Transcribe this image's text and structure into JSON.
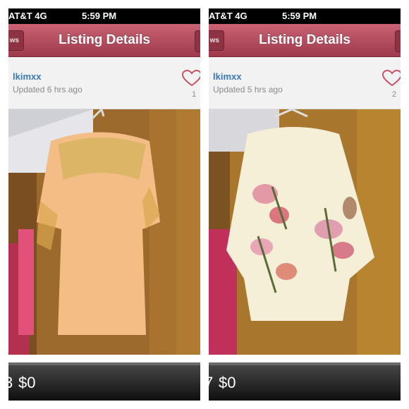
{
  "panels": [
    {
      "status": {
        "carrier": "AT&T  4G",
        "time": "5:59 PM"
      },
      "nav": {
        "back_label": "ws",
        "title": "Listing Details"
      },
      "seller": {
        "username": "lkimxx",
        "updated": "Updated 6 hrs ago",
        "likes": "1",
        "heart_icon": "heart-outline-icon"
      },
      "price": {
        "cut_number": "3",
        "amount": "$0"
      }
    },
    {
      "status": {
        "carrier": "AT&T  4G",
        "time": "5:59 PM"
      },
      "nav": {
        "back_label": "ws",
        "title": "Listing Details"
      },
      "seller": {
        "username": "lkimxx",
        "updated": "Updated 5 hrs ago",
        "likes": "2",
        "heart_icon": "heart-outline-icon"
      },
      "price": {
        "cut_number": "7",
        "amount": "$0"
      }
    }
  ],
  "colors": {
    "nav_top": "#c96273",
    "nav_bottom": "#9e3a4c",
    "username": "#3b78b8",
    "heart": "#c8546a"
  }
}
